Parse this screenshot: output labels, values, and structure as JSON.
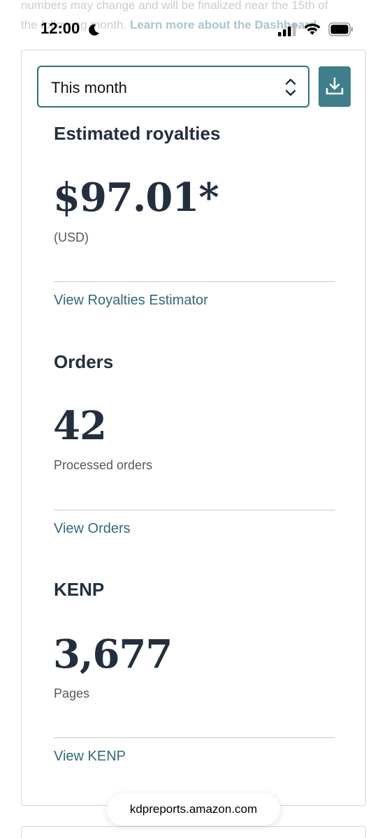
{
  "background_text": {
    "line1": "numbers may change and will be finalized near the 15th of",
    "line2_prefix": "the following month.",
    "link": "Learn more about the Dashboard"
  },
  "status_bar": {
    "time": "12:00",
    "icons": [
      "moon-icon",
      "signal-icon",
      "wifi-icon",
      "battery-icon"
    ]
  },
  "controls": {
    "period_selected": "This month",
    "download_icon": "download-icon"
  },
  "royalties": {
    "title": "Estimated royalties",
    "value": "$97.01*",
    "currency": "(USD)",
    "link": "View Royalties Estimator"
  },
  "orders": {
    "title": "Orders",
    "value": "42",
    "label": "Processed orders",
    "link": "View Orders"
  },
  "kenp": {
    "title": "KENP",
    "value": "3,677",
    "label": "Pages",
    "link": "View KENP"
  },
  "browser": {
    "url": "kdpreports.amazon.com"
  },
  "colors": {
    "accent": "#2d6c78",
    "button": "#3d7f8a",
    "text": "#232f3e",
    "muted": "#565959"
  }
}
